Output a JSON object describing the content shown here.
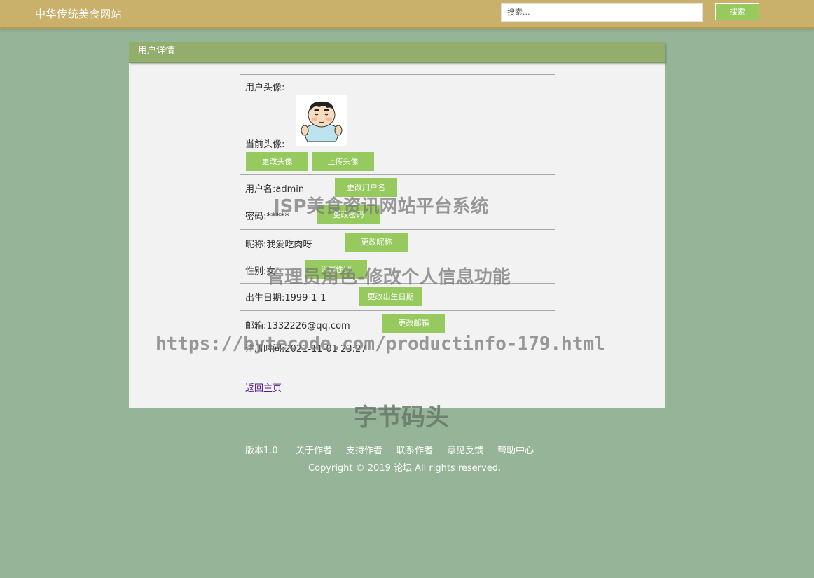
{
  "header": {
    "site_title": "中华传统美食网站",
    "search_placeholder": "搜索...",
    "search_button": "搜索"
  },
  "panel": {
    "title": "用户详情",
    "avatar_section_label": "用户头像:",
    "current_avatar_label": "当前头像:",
    "change_avatar_button": "更改头像",
    "upload_avatar_button": "上传头像",
    "fields": [
      {
        "label": "用户名:",
        "value": "admin",
        "button": "更改用户名"
      },
      {
        "label": "密码:",
        "value": "*****",
        "button": "更改密码"
      },
      {
        "label": "昵称:",
        "value": "我爱吃肉呀",
        "button": "更改昵称"
      },
      {
        "label": "性别:",
        "value": "女",
        "button": "设置性别"
      },
      {
        "label": "出生日期:",
        "value": "1999-1-1",
        "button": "更改出生日期"
      },
      {
        "label": "邮箱:",
        "value": "1332226@qq.com",
        "button": "更改邮箱"
      }
    ],
    "register_label": "注册时间:",
    "register_value": "2021-11-01 23:27",
    "back_link": "返回主页"
  },
  "footer": {
    "links": [
      "版本1.0",
      "关于作者",
      "支持作者",
      "联系作者",
      "意见反馈",
      "帮助中心"
    ],
    "copyright": "Copyright © 2019 论坛 All rights reserved."
  },
  "watermarks": [
    "JSP美食资讯网站平台系统",
    "管理员角色-修改个人信息功能",
    "https://bytecode.com/productinfo-179.html",
    "字节码头"
  ]
}
